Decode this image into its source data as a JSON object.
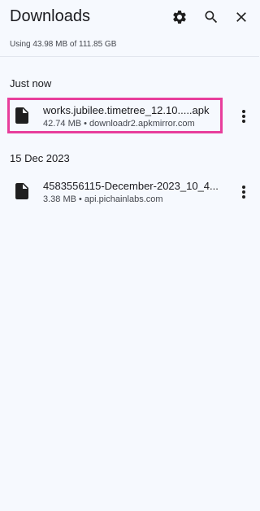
{
  "header": {
    "title": "Downloads",
    "settings_icon": "gear-icon",
    "search_icon": "search-icon",
    "close_icon": "close-icon"
  },
  "storage": {
    "text": "Using 43.98 MB of 111.85 GB"
  },
  "sections": [
    {
      "label": "Just now",
      "items": [
        {
          "name": "works.jubilee.timetree_12.10.....apk",
          "meta": "42.74 MB • downloadr2.apkmirror.com",
          "icon": "file-icon",
          "highlighted": true,
          "highlight_color": "#e83e9c"
        }
      ]
    },
    {
      "label": "15 Dec 2023",
      "items": [
        {
          "name": "4583556115-December-2023_10_4...",
          "meta": "3.38 MB • api.pichainlabs.com",
          "icon": "file-icon",
          "highlighted": false
        }
      ]
    }
  ],
  "colors": {
    "background": "#f6f9fe",
    "icon": "#1f1f1f",
    "secondary_text": "#44474e"
  }
}
